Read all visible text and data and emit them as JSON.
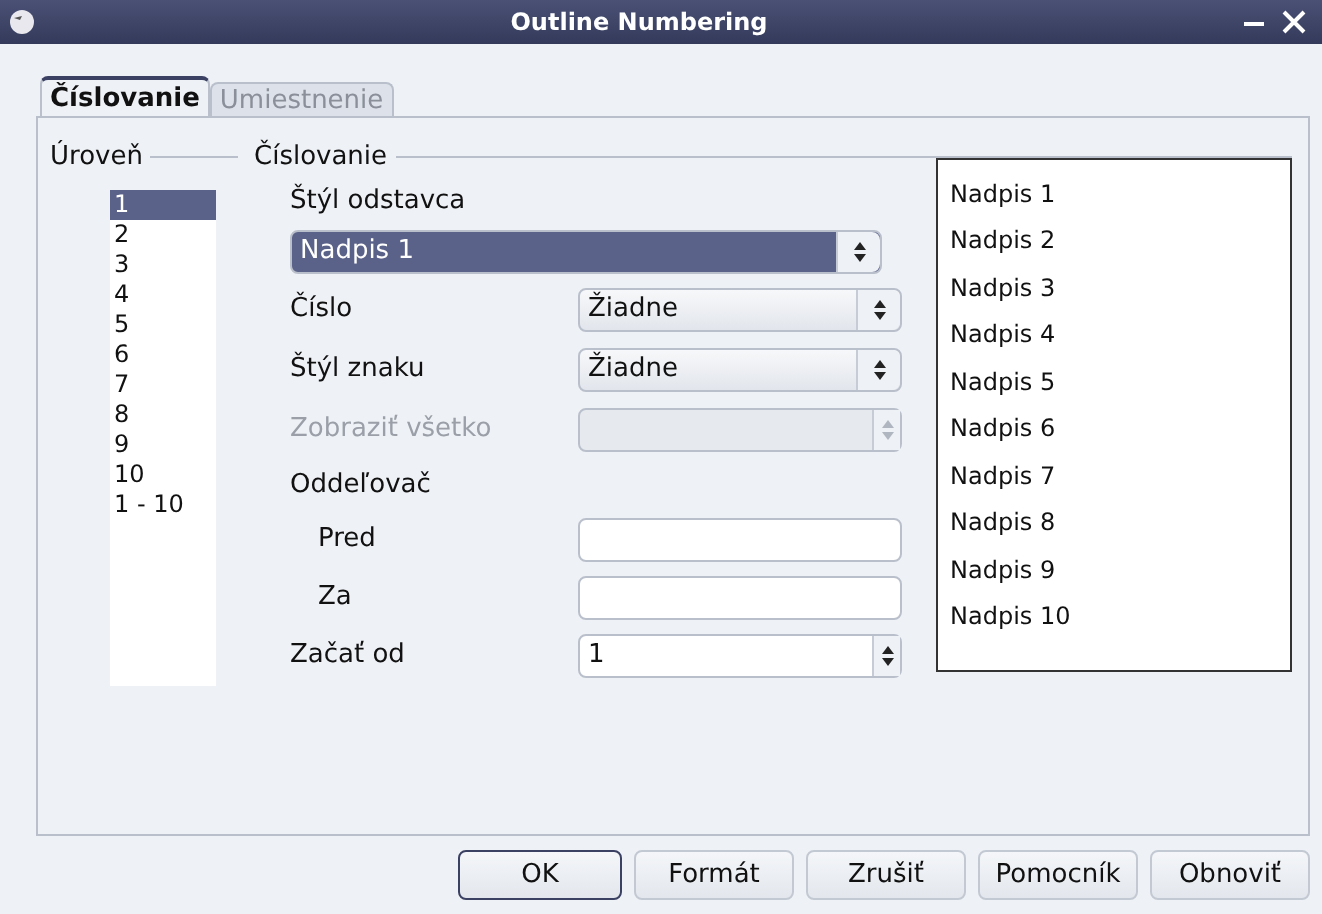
{
  "window": {
    "title": "Outline Numbering"
  },
  "tabs": [
    {
      "label": "Číslovanie",
      "selected": true
    },
    {
      "label": "Umiestnenie",
      "selected": false
    }
  ],
  "level_group": {
    "label": "Úroveň",
    "items": [
      {
        "label": "1",
        "selected": true
      },
      {
        "label": "2",
        "selected": false
      },
      {
        "label": "3",
        "selected": false
      },
      {
        "label": "4",
        "selected": false
      },
      {
        "label": "5",
        "selected": false
      },
      {
        "label": "6",
        "selected": false
      },
      {
        "label": "7",
        "selected": false
      },
      {
        "label": "8",
        "selected": false
      },
      {
        "label": "9",
        "selected": false
      },
      {
        "label": "10",
        "selected": false
      },
      {
        "label": "1 - 10",
        "selected": false
      }
    ]
  },
  "numbering_group": {
    "label": "Číslovanie",
    "paragraph_style": {
      "label": "Štýl odstavca",
      "value": "Nadpis 1"
    },
    "rows": [
      {
        "kind": "select",
        "label": "Číslo",
        "value": "Žiadne",
        "disabled": false
      },
      {
        "kind": "select",
        "label": "Štýl znaku",
        "value": "Žiadne",
        "disabled": false
      },
      {
        "kind": "spin",
        "label": "Zobraziť všetko",
        "disabled": true
      }
    ],
    "separator": {
      "label": "Oddeľovač",
      "rows": [
        {
          "kind": "text",
          "label": "Pred"
        },
        {
          "kind": "text",
          "label": "Za"
        }
      ]
    },
    "start_at": {
      "kind": "spin",
      "label": "Začať od",
      "value": "1",
      "disabled": false
    }
  },
  "preview": [
    "Nadpis 1",
    "Nadpis 2",
    "Nadpis 3",
    "Nadpis 4",
    "Nadpis 5",
    "Nadpis 6",
    "Nadpis 7",
    "Nadpis 8",
    "Nadpis 9",
    "Nadpis 10"
  ],
  "buttons": [
    {
      "label": "OK",
      "default": true
    },
    {
      "label": "Formát",
      "default": false
    },
    {
      "label": "Zrušiť",
      "default": false
    },
    {
      "label": "Pomocník",
      "default": false
    },
    {
      "label": "Obnoviť",
      "default": false
    }
  ]
}
